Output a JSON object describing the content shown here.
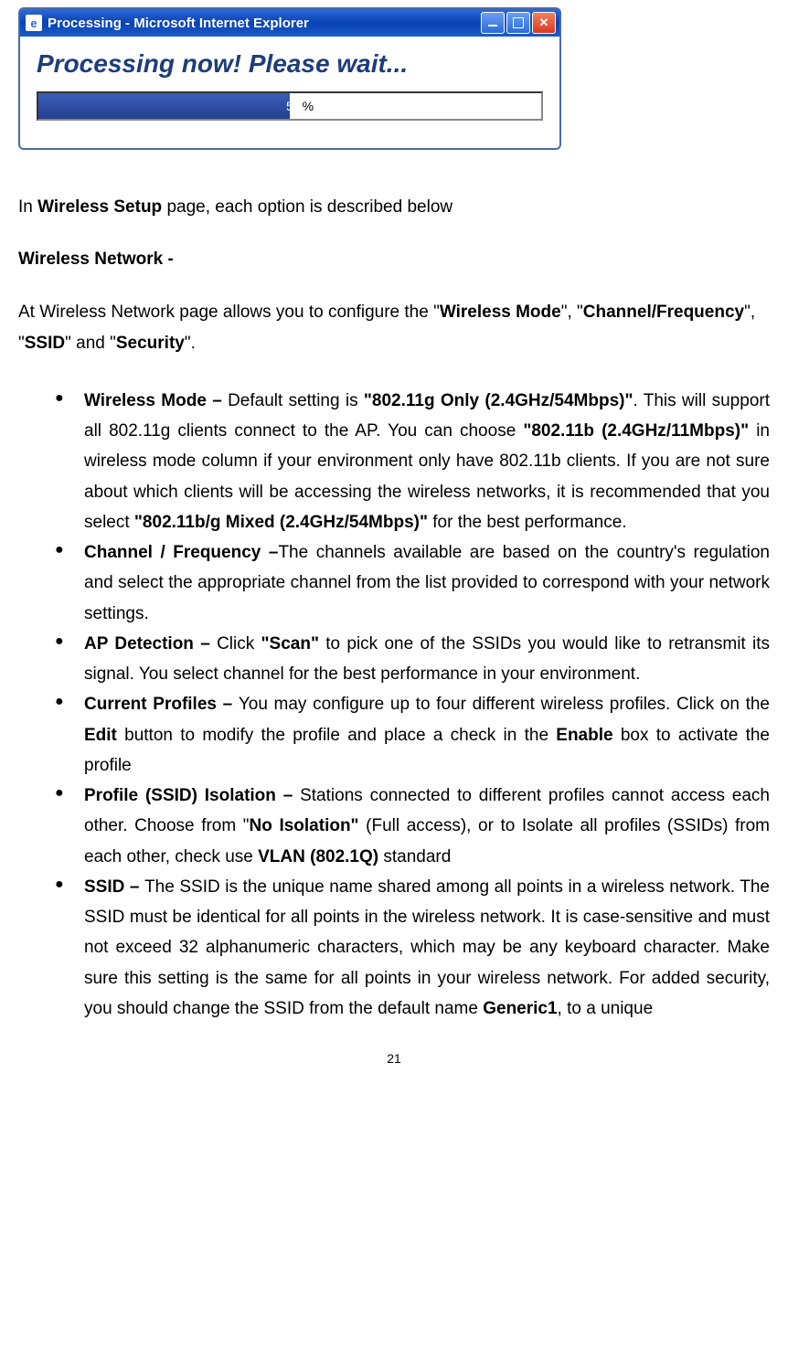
{
  "window": {
    "title": "Processing - Microsoft Internet Explorer",
    "heading": "Processing now! Please wait...",
    "progress_percent": "50",
    "progress_symbol": "%"
  },
  "intro": {
    "prefix": "In ",
    "bold1": "Wireless Setup",
    "suffix": " page, each option is described below"
  },
  "section_heading": "Wireless Network -",
  "config_intro": {
    "t1": "At Wireless Network page allows you to configure the \"",
    "b1": "Wireless Mode",
    "t2": "\", \"",
    "b2": "Channel/Frequency",
    "t3": "\", \"",
    "b3": "SSID",
    "t4": "\" and \"",
    "b4": "Security",
    "t5": "\"."
  },
  "bullets": [
    {
      "b1": "Wireless Mode – ",
      "t1": "Default setting is ",
      "b2": "\"802.11g Only (2.4GHz/54Mbps)\"",
      "t2": ". This will support all 802.11g clients connect to the AP. You can choose ",
      "b3": "\"802.11b (2.4GHz/11Mbps)\"",
      "t3": " in wireless mode column if your environment only have 802.11b clients. If you are not sure about which clients will be accessing the wireless networks, it is recommended that you select ",
      "b4": "\"802.11b/g Mixed (2.4GHz/54Mbps)\"",
      "t4": " for the best performance."
    },
    {
      "b1": "Channel / Frequency –",
      "t1": "The channels available are based on the country's regulation and select the appropriate channel from the list provided to correspond with your network settings."
    },
    {
      "b1": "AP Detection – ",
      "t1": "Click ",
      "b2": "\"Scan\"",
      "t2": " to pick one of the SSIDs you would like to retransmit its signal. You select channel for the best performance in your environment."
    },
    {
      "b1": "Current Profiles – ",
      "t1": "You may configure up to four different wireless profiles. Click on the ",
      "b2": "Edit",
      "t2": " button to modify the profile and place a check in the ",
      "b3": "Enable",
      "t3": " box to activate the profile"
    },
    {
      "b1": "Profile (SSID) Isolation – ",
      "t1": "Stations connected to different profiles cannot access each other. Choose from \"",
      "b2": "No Isolation\"",
      "t2": " (Full access), or to Isolate all profiles (SSIDs) from each other, check use ",
      "b3": "VLAN (802.1Q)",
      "t3": " standard"
    },
    {
      "b1": "SSID – ",
      "t1": "The SSID is the unique name shared among all points in a wireless network. The SSID must be identical for all points in the wireless network. It is case-sensitive and must not exceed 32 alphanumeric characters, which may be any keyboard character. Make sure this setting is the same for all points in your wireless network. For added security, you should change the SSID from the default name ",
      "b2": "Generic1",
      "t2": ", to a unique"
    }
  ],
  "page_number": "21"
}
